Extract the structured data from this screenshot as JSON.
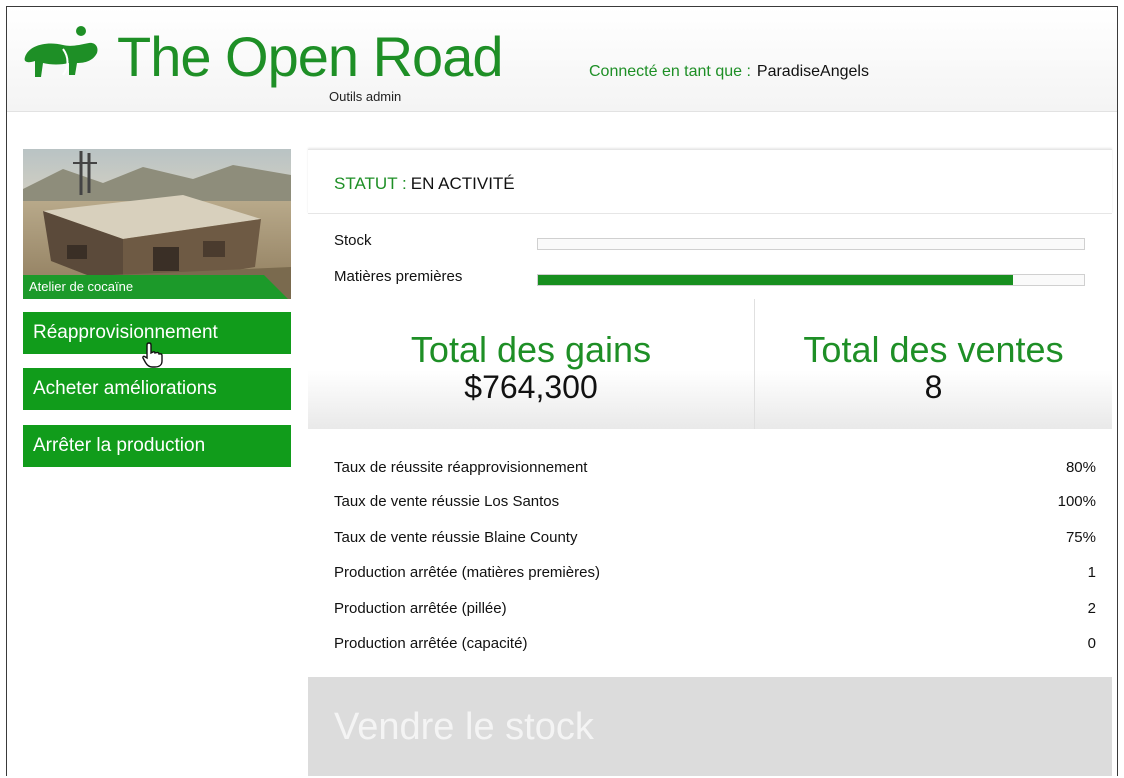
{
  "header": {
    "brand_title": "The Open Road",
    "brand_subtitle": "Outils admin",
    "connected_label": "Connecté en tant que :",
    "username": "ParadiseAngels"
  },
  "business": {
    "label": "Atelier de cocaïne"
  },
  "sidebar": {
    "buttons": [
      {
        "label": "Réapprovisionnement"
      },
      {
        "label": "Acheter améliorations"
      },
      {
        "label": "Arrêter la production"
      }
    ]
  },
  "status": {
    "key": "STATUT :",
    "value": "EN ACTIVITÉ"
  },
  "bars": [
    {
      "label": "Stock",
      "fill_fraction": 0.0
    },
    {
      "label": "Matières premières",
      "fill_fraction": 0.87
    }
  ],
  "totals": {
    "earnings_title": "Total des gains",
    "earnings_value": "$764,300",
    "sales_title": "Total des ventes",
    "sales_value": "8"
  },
  "stats": [
    {
      "label": "Taux de réussite réapprovisionnement",
      "value": "80%"
    },
    {
      "label": "Taux de vente réussie Los Santos",
      "value": "100%"
    },
    {
      "label": "Taux de vente réussie Blaine County",
      "value": "75%"
    },
    {
      "label": "Production arrêtée (matières premières)",
      "value": "1"
    },
    {
      "label": "Production arrêtée (pillée)",
      "value": "2"
    },
    {
      "label": "Production arrêtée (capacité)",
      "value": "0"
    }
  ],
  "sell_button": {
    "label": "Vendre le stock"
  },
  "colors": {
    "brand_green": "#1e8f26",
    "button_green": "#119c1b",
    "disabled_grey": "#dcdcdc"
  },
  "icons": {
    "logo": "motorcycle-logo-icon",
    "cursor": "hand-pointer-icon"
  }
}
